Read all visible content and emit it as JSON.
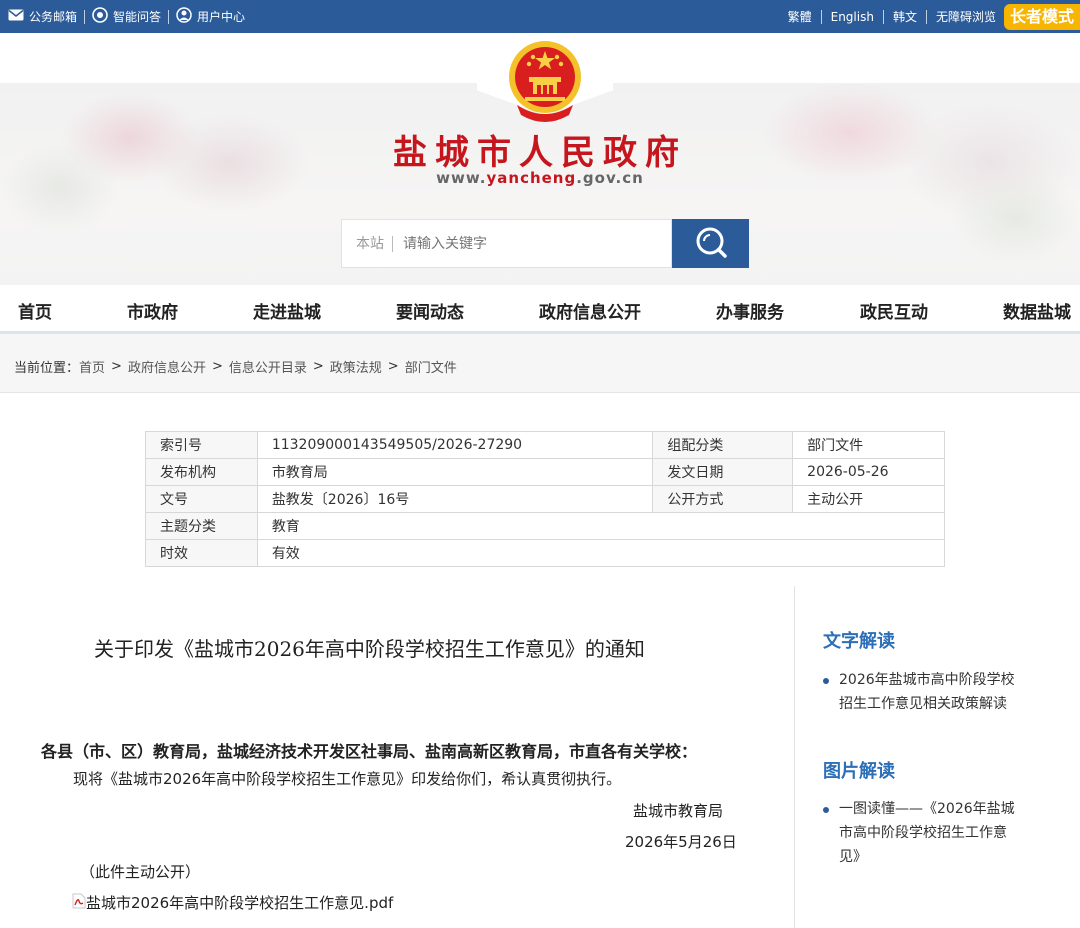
{
  "topbar": {
    "left_items": [
      {
        "icon": "mail-icon",
        "label": "公务邮箱"
      },
      {
        "icon": "qa-icon",
        "label": "智能问答"
      },
      {
        "icon": "user-icon",
        "label": "用户中心"
      }
    ],
    "right_links": [
      "繁體",
      "English",
      "韩文",
      "无障碍浏览"
    ],
    "elder_mode": "长者模式",
    "bar_color": "#2c5b9a",
    "elder_color": "#f7b500"
  },
  "header": {
    "title": "盐城市人民政府",
    "url_prefix": "www.",
    "url_highlight": "yancheng",
    "url_suffix": ".gov.cn",
    "title_color": "#c4161c",
    "emblem": "national-emblem-icon"
  },
  "search": {
    "scope": "本站",
    "placeholder": "请输入关键字",
    "button_icon": "search-icon"
  },
  "nav": {
    "items": [
      "首页",
      "市政府",
      "走进盐城",
      "要闻动态",
      "政府信息公开",
      "办事服务",
      "政民互动",
      "数据盐城"
    ]
  },
  "breadcrumb": {
    "label": "当前位置：",
    "items": [
      "首页",
      "政府信息公开",
      "信息公开目录",
      "政策法规",
      "部门文件"
    ],
    "separator": ">"
  },
  "info_table": {
    "index_label": "索引号",
    "index_value": "113209000143549505/2026-27290",
    "category_label": "组配分类",
    "category_value": "部门文件",
    "publisher_label": "发布机构",
    "publisher_value": "市教育局",
    "date_label": "发文日期",
    "date_value": "2026-05-26",
    "docno_label": "文号",
    "docno_value": "盐教发〔2026〕16号",
    "open_label": "公开方式",
    "open_value": "主动公开",
    "topic_label": "主题分类",
    "topic_value": "教育",
    "validity_label": "时效",
    "validity_value": "有效"
  },
  "article": {
    "title": "关于印发《盐城市2026年高中阶段学校招生工作意见》的通知",
    "addressee": "各县（市、区）教育局，盐城经济技术开发区社事局、盐南高新区教育局，市直各有关学校：",
    "body": "现将《盐城市2026年高中阶段学校招生工作意见》印发给你们，希认真贯彻执行。",
    "signer": "盐城市教育局",
    "sign_date": "2026年5月26日",
    "public_note": "（此件主动公开）",
    "attachment": "盐城市2026年高中阶段学校招生工作意见.pdf",
    "attachment_icon": "pdf-icon"
  },
  "sidebar": {
    "text_heading": "文字解读",
    "text_item_line1": "2026年盐城市高中阶段学校",
    "text_item_line2": "招生工作意见相关政策解读",
    "image_heading": "图片解读",
    "image_item_line1": "一图读懂——《2026年盐城",
    "image_item_line2": "市高中阶段学校招生工作意",
    "image_item_line3": "见》",
    "heading_color": "#2c6fb7"
  }
}
